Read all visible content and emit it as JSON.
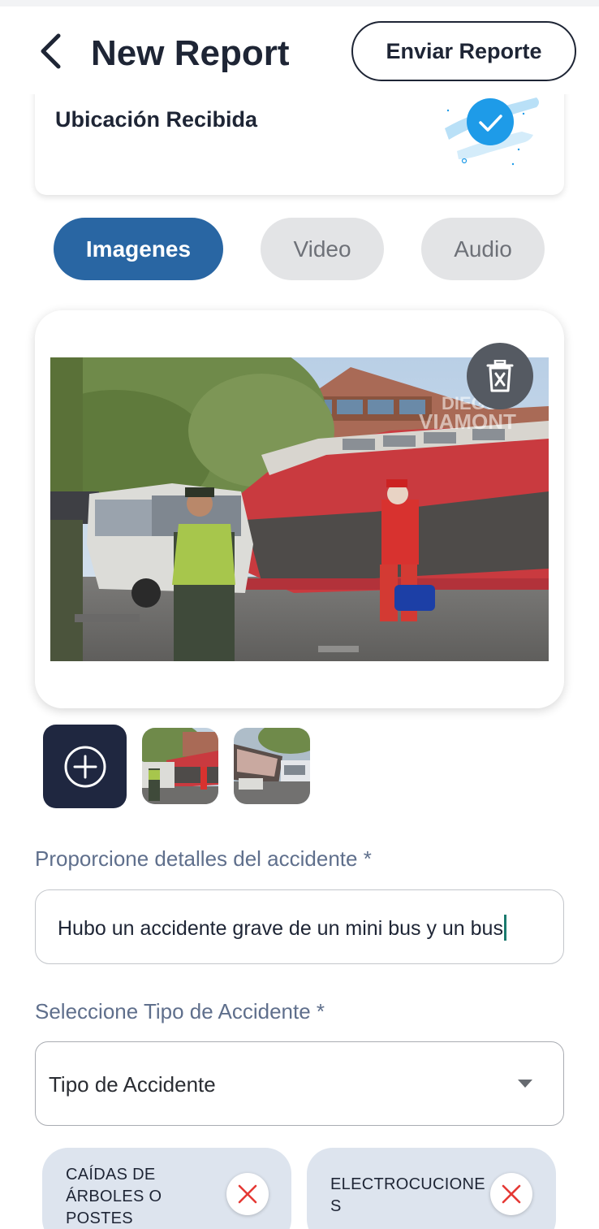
{
  "header": {
    "back_icon": "chevron-left-icon",
    "title": "New Report",
    "send_button": "Enviar Reporte"
  },
  "location": {
    "label": "Ubicación Recibida",
    "status_icon": "check-circle-icon"
  },
  "media_tabs": [
    {
      "label": "Imagenes",
      "active": true
    },
    {
      "label": "Video",
      "active": false
    },
    {
      "label": "Audio",
      "active": false
    }
  ],
  "preview": {
    "watermark_line1": "DIEGO",
    "watermark_line2": "VIAMONT",
    "delete_icon": "trash-icon",
    "add_icon": "plus-circle-icon"
  },
  "details": {
    "label": "Proporcione detalles del accidente *",
    "value": "Hubo un accidente grave de un mini bus y un bus"
  },
  "accident_type": {
    "label": "Seleccione Tipo de Accidente *",
    "selected": "Tipo de Accidente"
  },
  "chips": [
    {
      "label": "CAÍDAS DE ÁRBOLES O POSTES"
    },
    {
      "label": "ELECTROCUCIONES"
    }
  ],
  "colors": {
    "primary": "#2966a3",
    "dark": "#1e2535",
    "tab_inactive": "#e3e4e6",
    "chip_bg": "#dde4ee",
    "chip_close": "#e53935"
  }
}
